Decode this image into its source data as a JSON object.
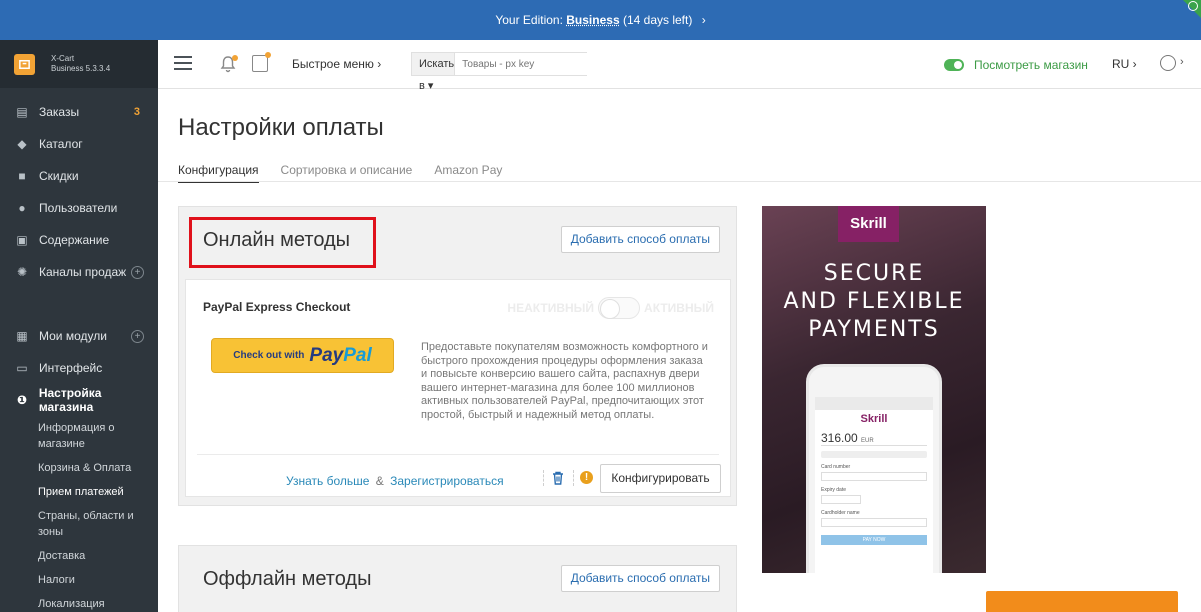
{
  "banner": {
    "prefix": "Your Edition:",
    "edition": "Business",
    "trial": "(14 days left)",
    "chevron": "›"
  },
  "brand": {
    "name": "X-Cart",
    "version": "Business 5.3.3.4"
  },
  "sidebar": {
    "items": [
      {
        "label": "Заказы",
        "icon": "orders-icon",
        "badge": "3"
      },
      {
        "label": "Каталог",
        "icon": "tag-icon"
      },
      {
        "label": "Скидки",
        "icon": "gift-icon"
      },
      {
        "label": "Пользователи",
        "icon": "users-icon"
      },
      {
        "label": "Содержание",
        "icon": "content-icon"
      },
      {
        "label": "Каналы продаж",
        "icon": "sales-channels-icon",
        "plus": "+"
      }
    ],
    "items2": [
      {
        "label": "Мои модули",
        "icon": "modules-icon",
        "plus": "+"
      },
      {
        "label": "Интерфейс",
        "icon": "interface-icon"
      },
      {
        "label": "Настройка магазина",
        "icon": "info-icon"
      }
    ],
    "subitems": [
      "Информация о магазине",
      "Корзина & Оплата",
      "Прием платежей",
      "Страны, области и зоны",
      "Доставка",
      "Налоги",
      "Локализация"
    ]
  },
  "topbar": {
    "quick_menu": "Быстрое меню ›",
    "search_select": "Искать в ▾",
    "search_placeholder": "Товары - px key",
    "view_store": "Посмотреть магазин",
    "lang": "RU ›",
    "user_chevron": "›"
  },
  "page": {
    "title": "Настройки оплаты",
    "tabs": [
      "Конфигурация",
      "Сортировка и описание",
      "Amazon Pay"
    ]
  },
  "online": {
    "title": "Онлайн методы",
    "add_button": "Добавить способ оплаты",
    "method": {
      "name": "PayPal Express Checkout",
      "inactive": "НЕАКТИВНЫЙ",
      "active": "АКТИВНЫЙ",
      "pp_small": "Check out with",
      "pp_pay": "Pay",
      "pp_pal": "Pal",
      "description": "Предоставьте покупателям возможность комфортного и быстрого прохождения процедуры оформления заказа и повысьте конверсию вашего сайта, распахнув двери вашего интернет-магазина для более 100 миллионов активных пользователей PayPal, предпочитающих этот простой, быстрый и надежный метод оплаты.",
      "learn_more": "Узнать больше",
      "amp": "&",
      "register": "Зарегистрироваться",
      "warn": "!",
      "configure": "Конфигурировать"
    }
  },
  "offline": {
    "title": "Оффлайн методы",
    "add_button": "Добавить способ оплаты"
  },
  "ad": {
    "logo": "Skrill",
    "headline_1": "SECURE",
    "headline_2": "AND FLEXIBLE",
    "headline_3": "PAYMENTS",
    "phone_brand": "Skrill",
    "phone_amount": "316.00",
    "phone_currency": "EUR",
    "phone_card_label": "Card number",
    "phone_expiry_label": "Expiry date",
    "phone_holder_label": "Cardholder name",
    "phone_pay": "PAY NOW"
  },
  "colors": {
    "banner": "#2d6bb4",
    "sidebar": "#2e363d",
    "accent": "#f2a335",
    "highlight": "#e0111b",
    "link": "#2a6db0"
  }
}
